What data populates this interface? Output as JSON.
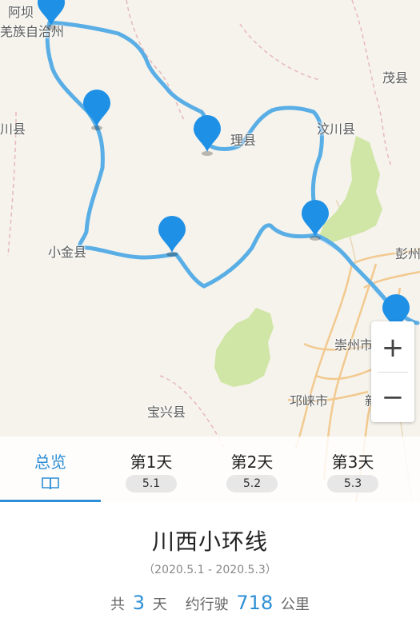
{
  "map": {
    "places": [
      {
        "id": "aba",
        "text": "阿坝"
      },
      {
        "id": "qiang",
        "text": "羌族自治州"
      },
      {
        "id": "xiaojin-county",
        "text": "小金县"
      },
      {
        "id": "li",
        "text": "理县"
      },
      {
        "id": "wenchuan",
        "text": "汶川县"
      },
      {
        "id": "mao",
        "text": "茂县"
      },
      {
        "id": "chuan-left",
        "text": "川县"
      },
      {
        "id": "xiaojin",
        "text": "小金县"
      },
      {
        "id": "pengzhou",
        "text": "彭州"
      },
      {
        "id": "chongzhou",
        "text": "崇州市"
      },
      {
        "id": "qionglai",
        "text": "邛崃市"
      },
      {
        "id": "baoxing",
        "text": "宝兴县"
      },
      {
        "id": "xin",
        "text": "新"
      }
    ],
    "route_color": "#5aaee6",
    "pin_color": "#1e90e6",
    "zoom_in": "+",
    "zoom_out": "−"
  },
  "tabs": [
    {
      "title": "总览",
      "icon": "book-icon"
    },
    {
      "title": "第1天",
      "date": "5.1"
    },
    {
      "title": "第2天",
      "date": "5.2"
    },
    {
      "title": "第3天",
      "date": "5.3"
    }
  ],
  "trip": {
    "title": "川西小环线",
    "dates": "（2020.5.1 - 2020.5.3）",
    "prefix": "共",
    "days": "3",
    "days_unit": "天",
    "dist_prefix": "约行驶",
    "distance": "718",
    "dist_unit": "公里"
  },
  "accent": "#2e8fd6"
}
